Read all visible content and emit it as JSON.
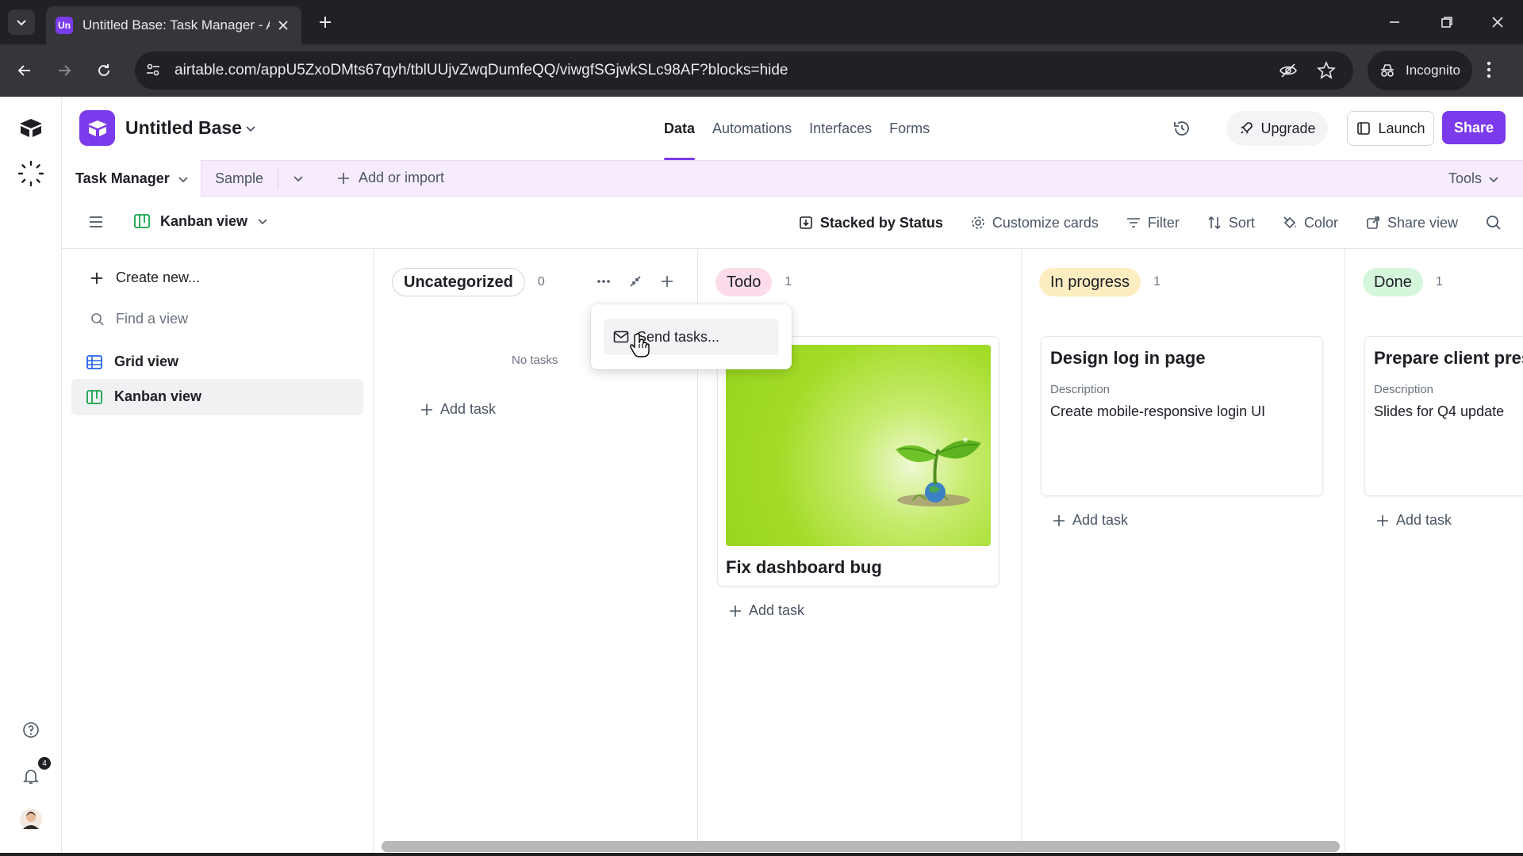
{
  "browser": {
    "tab_title": "Untitled Base: Task Manager - A",
    "tab_favicon_text": "Un",
    "url": "airtable.com/appU5ZxoDMts67qyh/tblUUjvZwqDumfeQQ/viwgfSGjwkSLc98AF?blocks=hide",
    "incognito_label": "Incognito"
  },
  "rail": {
    "notification_count": "4"
  },
  "header": {
    "base_name": "Untitled Base",
    "tabs": [
      {
        "label": "Data",
        "active": true
      },
      {
        "label": "Automations"
      },
      {
        "label": "Interfaces"
      },
      {
        "label": "Forms"
      }
    ],
    "upgrade_label": "Upgrade",
    "launch_label": "Launch",
    "share_label": "Share",
    "accent_color": "#7c3aed"
  },
  "tables": {
    "active": "Task Manager",
    "other": "Sample",
    "add_label": "Add or import",
    "tools_label": "Tools"
  },
  "viewbar": {
    "current_view": "Kanban view",
    "stacked_by": "Stacked by Status",
    "customize": "Customize cards",
    "filter": "Filter",
    "sort": "Sort",
    "color": "Color",
    "share_view": "Share view"
  },
  "sidebar": {
    "create_new": "Create new...",
    "find_placeholder": "Find a view",
    "views": [
      {
        "label": "Grid view",
        "icon": "grid-icon"
      },
      {
        "label": "Kanban view",
        "icon": "kanban-icon",
        "selected": true
      }
    ]
  },
  "board": {
    "add_task_label": "Add task",
    "columns": [
      {
        "name": "Uncategorized",
        "count": "0",
        "empty_text": "No tasks"
      },
      {
        "name": "Todo",
        "count": "1",
        "color": "#fcdcea",
        "cards": [
          {
            "title": "Fix dashboard bug",
            "has_image": true
          }
        ]
      },
      {
        "name": "In progress",
        "count": "1",
        "color": "#ffedc2",
        "cards": [
          {
            "title": "Design log in page",
            "description_label": "Description",
            "description": "Create mobile-responsive login UI"
          }
        ]
      },
      {
        "name": "Done",
        "count": "1",
        "color": "#d4f7dc",
        "cards": [
          {
            "title": "Prepare client pres",
            "description_label": "Description",
            "description": "Slides for Q4 update"
          }
        ]
      }
    ]
  },
  "menu": {
    "item": "Send tasks..."
  }
}
